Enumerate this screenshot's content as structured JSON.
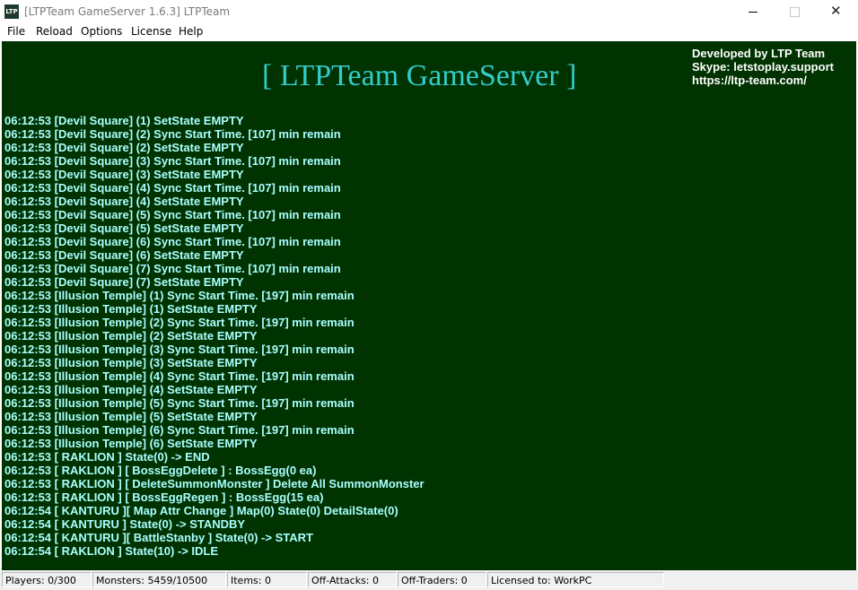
{
  "window": {
    "icon_text": "LTP",
    "title": "[LTPTeam GameServer 1.6.3] LTPTeam",
    "close_glyph": "✕"
  },
  "menu": [
    "File",
    "Reload",
    "Options",
    "License",
    "Help"
  ],
  "banner": "[ LTPTeam GameServer ]",
  "developer": {
    "line1": "Developed by LTP Team",
    "line2": "Skype: letstoplay.support",
    "line3": "https://ltp-team.com/"
  },
  "log_lines": [
    "06:12:53 [Devil Square] (1) SetState EMPTY",
    "06:12:53 [Devil Square] (2) Sync Start Time. [107] min remain",
    "06:12:53 [Devil Square] (2) SetState EMPTY",
    "06:12:53 [Devil Square] (3) Sync Start Time. [107] min remain",
    "06:12:53 [Devil Square] (3) SetState EMPTY",
    "06:12:53 [Devil Square] (4) Sync Start Time. [107] min remain",
    "06:12:53 [Devil Square] (4) SetState EMPTY",
    "06:12:53 [Devil Square] (5) Sync Start Time. [107] min remain",
    "06:12:53 [Devil Square] (5) SetState EMPTY",
    "06:12:53 [Devil Square] (6) Sync Start Time. [107] min remain",
    "06:12:53 [Devil Square] (6) SetState EMPTY",
    "06:12:53 [Devil Square] (7) Sync Start Time. [107] min remain",
    "06:12:53 [Devil Square] (7) SetState EMPTY",
    "06:12:53 [Illusion Temple] (1) Sync Start Time. [197] min remain",
    "06:12:53 [Illusion Temple] (1) SetState EMPTY",
    "06:12:53 [Illusion Temple] (2) Sync Start Time. [197] min remain",
    "06:12:53 [Illusion Temple] (2) SetState EMPTY",
    "06:12:53 [Illusion Temple] (3) Sync Start Time. [197] min remain",
    "06:12:53 [Illusion Temple] (3) SetState EMPTY",
    "06:12:53 [Illusion Temple] (4) Sync Start Time. [197] min remain",
    "06:12:53 [Illusion Temple] (4) SetState EMPTY",
    "06:12:53 [Illusion Temple] (5) Sync Start Time. [197] min remain",
    "06:12:53 [Illusion Temple] (5) SetState EMPTY",
    "06:12:53 [Illusion Temple] (6) Sync Start Time. [197] min remain",
    "06:12:53 [Illusion Temple] (6) SetState EMPTY",
    "06:12:53 [ RAKLION ] State(0) -> END",
    "06:12:53 [ RAKLION ] [ BossEggDelete ] : BossEgg(0 ea)",
    "06:12:53 [ RAKLION ] [ DeleteSummonMonster ] Delete All SummonMonster",
    "06:12:53 [ RAKLION ] [ BossEggRegen ] : BossEgg(15 ea)",
    "06:12:54 [ KANTURU ][ Map Attr Change ] Map(0) State(0) DetailState(0)",
    "06:12:54 [ KANTURU ] State(0) -> STANDBY",
    "06:12:54 [ KANTURU ][ BattleStanby ] State(0) -> START",
    "06:12:54 [ RAKLION ] State(10) -> IDLE"
  ],
  "status": {
    "players": "Players: 0/300",
    "monsters": "Monsters: 5459/10500",
    "items": "Items: 0",
    "off_attacks": "Off-Attacks: 0",
    "off_traders": "Off-Traders: 0",
    "license": "Licensed to: WorkPC"
  }
}
